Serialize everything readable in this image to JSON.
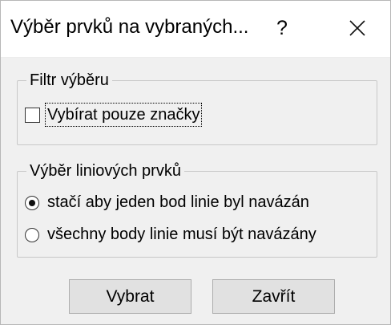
{
  "window": {
    "title": "Výběr prvků na vybraných...",
    "help_label": "?",
    "close_icon": "close-icon"
  },
  "filter_group": {
    "legend": "Filtr výběru",
    "options": [
      {
        "label": "Vybírat pouze značky",
        "checked": false
      }
    ]
  },
  "line_group": {
    "legend": "Výběr liniových prvků",
    "options": [
      {
        "label": "stačí aby jeden bod linie byl navázán",
        "selected": true
      },
      {
        "label": "všechny body linie musí být navázány",
        "selected": false
      }
    ]
  },
  "buttons": {
    "select_label": "Vybrat",
    "close_label": "Zavřít"
  },
  "colors": {
    "title_bar": "#ffffff",
    "dialog_bg": "#f0f0f0",
    "button_bg": "#e1e1e1",
    "group_border": "#c8c8c8"
  }
}
